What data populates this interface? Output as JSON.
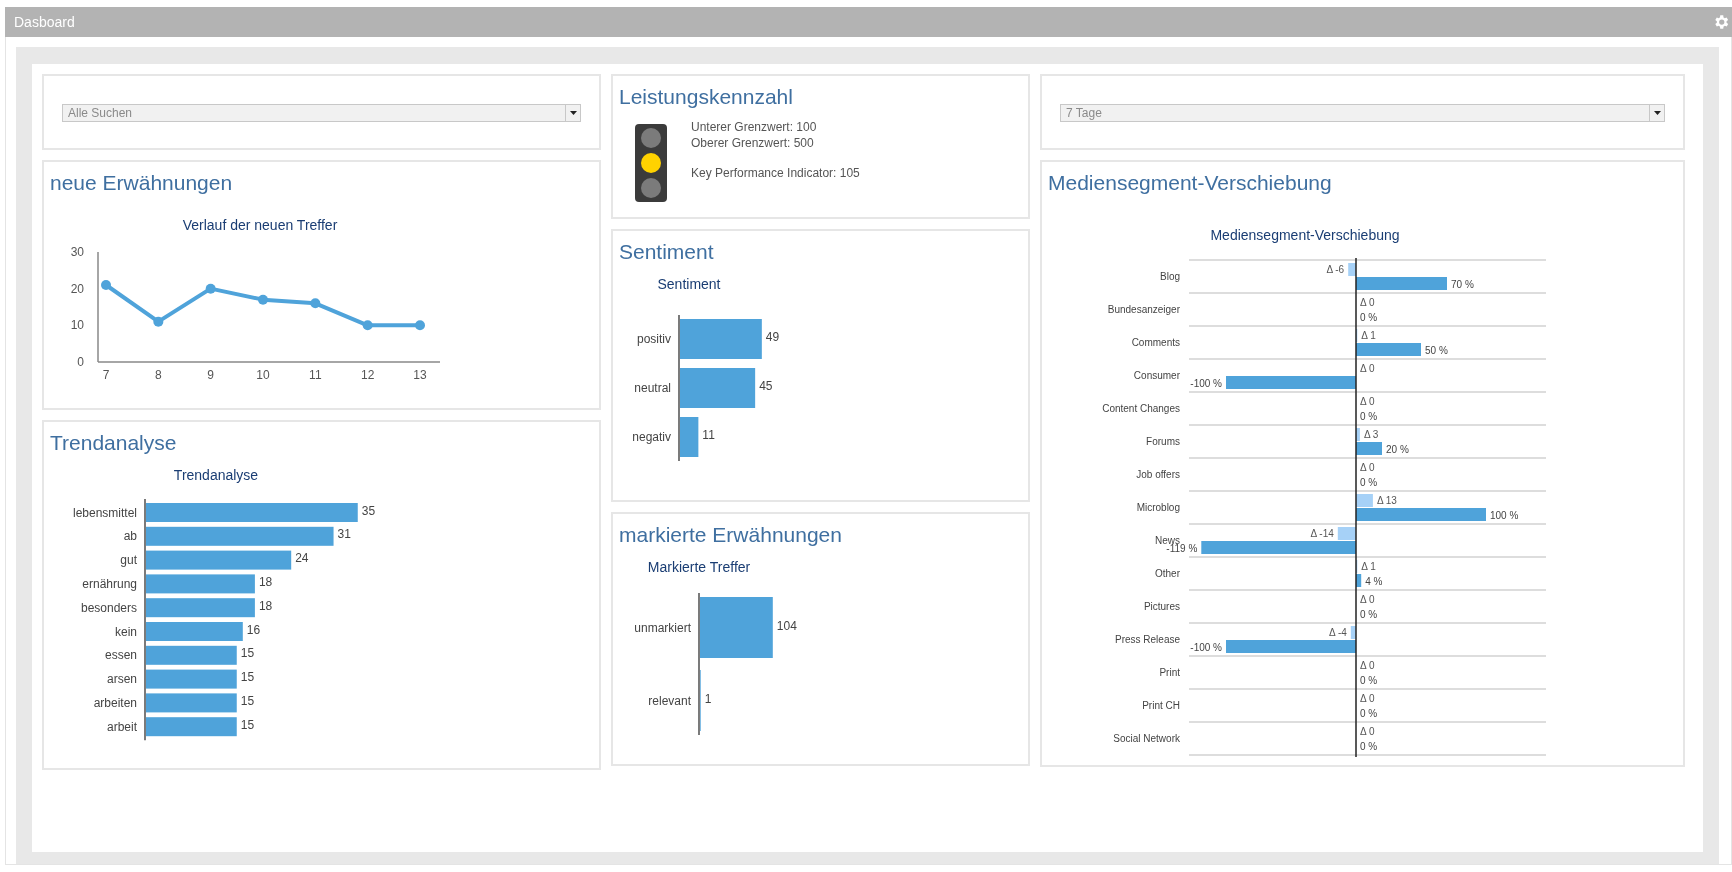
{
  "window": {
    "title": "Dasboard"
  },
  "left": {
    "filter": {
      "value": "Alle Suchen"
    },
    "mentions": {
      "title": "neue Erwähnungen",
      "chart_data": {
        "type": "line",
        "title": "Verlauf der neuen Treffer",
        "x": [
          "7",
          "8",
          "9",
          "10",
          "11",
          "12",
          "13"
        ],
        "series": [
          {
            "color": "#4fa3da",
            "marker": true,
            "values": [
              21,
              11,
              20,
              17,
              16,
              10,
              10
            ]
          }
        ],
        "ylim": [
          0,
          30
        ],
        "yticks": [
          0,
          10,
          20,
          30
        ]
      }
    },
    "trend": {
      "title": "Trendanalyse",
      "chart_data": {
        "type": "bar",
        "orientation": "horizontal",
        "title": "Trendanalyse",
        "categories": [
          "lebensmittel",
          "ab",
          "gut",
          "ernährung",
          "besonders",
          "kein",
          "essen",
          "arsen",
          "arbeiten",
          "arbeit"
        ],
        "series": [
          {
            "color": "#4fa3da",
            "values": [
              35,
              31,
              24,
              18,
              18,
              16,
              15,
              15,
              15,
              15
            ]
          }
        ],
        "data_labels": true
      }
    }
  },
  "middle": {
    "kpi": {
      "title": "Leistungskennzahl",
      "lights": [
        {
          "on": false
        },
        {
          "on": true
        },
        {
          "on": false
        }
      ],
      "lines": [
        "Unterer Grenzwert: 100",
        "Oberer Grenzwert: 500",
        "Key Performance Indicator: 105"
      ]
    },
    "sentiment": {
      "title": "Sentiment",
      "chart_data": {
        "type": "bar",
        "orientation": "horizontal",
        "title": "Sentiment",
        "categories": [
          "positiv",
          "neutral",
          "negativ"
        ],
        "series": [
          {
            "color": "#4fa3da",
            "values": [
              49,
              45,
              11
            ]
          }
        ],
        "data_labels": true
      }
    },
    "marked": {
      "title": "markierte Erwähnungen",
      "chart_data": {
        "type": "bar",
        "orientation": "horizontal",
        "title": "Markierte Treffer",
        "categories": [
          "unmarkiert",
          "relevant"
        ],
        "series": [
          {
            "color": "#4fa3da",
            "values": [
              104,
              1
            ]
          }
        ],
        "data_labels": true
      }
    }
  },
  "right": {
    "filter": {
      "value": "7 Tage"
    },
    "media": {
      "title": "Mediensegment-Verschiebung",
      "chart_data": {
        "type": "bar",
        "orientation": "horizontal",
        "title": "Mediensegment-Verschiebung",
        "categories": [
          "Blog",
          "Bundesanzeiger",
          "Comments",
          "Consumer",
          "Content Changes",
          "Forums",
          "Job offers",
          "Microblog",
          "News",
          "Other",
          "Pictures",
          "Press Release",
          "Print",
          "Print CH",
          "Social Network"
        ],
        "series": [
          {
            "color": "#a6d1f7",
            "values": [
              -6,
              0,
              1,
              0,
              0,
              3,
              0,
              13,
              -14,
              1,
              0,
              -4,
              0,
              0,
              0
            ],
            "value_labels": [
              "Δ -6",
              "Δ 0",
              "Δ 1",
              "Δ 0",
              "Δ 0",
              "Δ 3",
              "Δ 0",
              "Δ 13",
              "Δ -14",
              "Δ 1",
              "Δ 0",
              "Δ -4",
              "Δ 0",
              "Δ 0",
              "Δ 0"
            ]
          },
          {
            "color": "#4fa3da",
            "values": [
              70,
              0,
              50,
              -100,
              0,
              20,
              0,
              100,
              -119,
              4,
              0,
              -100,
              0,
              0,
              0
            ],
            "value_labels": [
              "70 %",
              "0 %",
              "50 %",
              "-100 %",
              "0 %",
              "20 %",
              "0 %",
              "100 %",
              "-119 %",
              "4 %",
              "0 %",
              "-100 %",
              "0 %",
              "0 %",
              "0 %"
            ]
          }
        ]
      }
    }
  }
}
